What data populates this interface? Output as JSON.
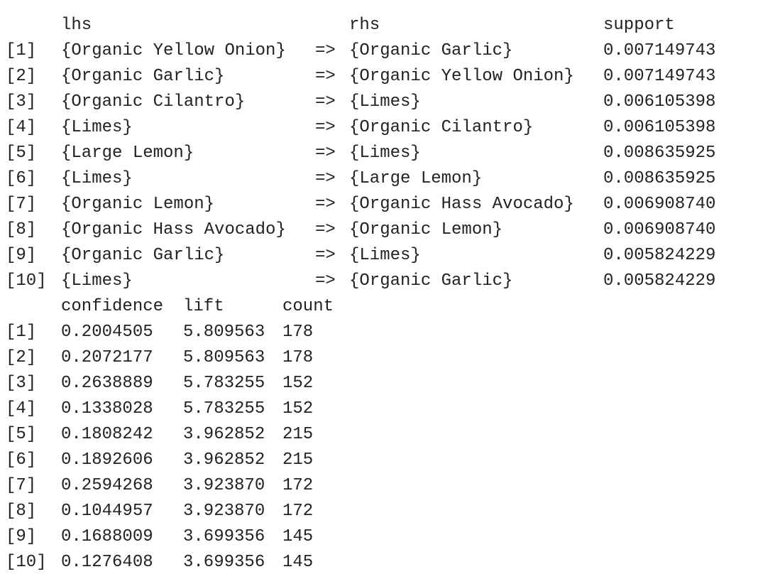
{
  "rules_table": {
    "headers": {
      "lhs": "lhs",
      "rhs": "rhs",
      "support": "support"
    },
    "rows": [
      {
        "idx": "[1]",
        "lhs": "{Organic Yellow Onion}",
        "arrow": "=>",
        "rhs": "{Organic Garlic}",
        "support": "0.007149743"
      },
      {
        "idx": "[2]",
        "lhs": "{Organic Garlic}",
        "arrow": "=>",
        "rhs": "{Organic Yellow Onion}",
        "support": "0.007149743"
      },
      {
        "idx": "[3]",
        "lhs": "{Organic Cilantro}",
        "arrow": "=>",
        "rhs": "{Limes}",
        "support": "0.006105398"
      },
      {
        "idx": "[4]",
        "lhs": "{Limes}",
        "arrow": "=>",
        "rhs": "{Organic Cilantro}",
        "support": "0.006105398"
      },
      {
        "idx": "[5]",
        "lhs": "{Large Lemon}",
        "arrow": "=>",
        "rhs": "{Limes}",
        "support": "0.008635925"
      },
      {
        "idx": "[6]",
        "lhs": "{Limes}",
        "arrow": "=>",
        "rhs": "{Large Lemon}",
        "support": "0.008635925"
      },
      {
        "idx": "[7]",
        "lhs": "{Organic Lemon}",
        "arrow": "=>",
        "rhs": "{Organic Hass Avocado}",
        "support": "0.006908740"
      },
      {
        "idx": "[8]",
        "lhs": "{Organic Hass Avocado}",
        "arrow": "=>",
        "rhs": "{Organic Lemon}",
        "support": "0.006908740"
      },
      {
        "idx": "[9]",
        "lhs": "{Organic Garlic}",
        "arrow": "=>",
        "rhs": "{Limes}",
        "support": "0.005824229"
      },
      {
        "idx": "[10]",
        "lhs": "{Limes}",
        "arrow": "=>",
        "rhs": "{Organic Garlic}",
        "support": "0.005824229"
      }
    ]
  },
  "metrics_table": {
    "headers": {
      "confidence": "confidence",
      "lift": "lift",
      "count": "count"
    },
    "rows": [
      {
        "idx": "[1]",
        "confidence": "0.2004505",
        "lift": "5.809563",
        "count": "178"
      },
      {
        "idx": "[2]",
        "confidence": "0.2072177",
        "lift": "5.809563",
        "count": "178"
      },
      {
        "idx": "[3]",
        "confidence": "0.2638889",
        "lift": "5.783255",
        "count": "152"
      },
      {
        "idx": "[4]",
        "confidence": "0.1338028",
        "lift": "5.783255",
        "count": "152"
      },
      {
        "idx": "[5]",
        "confidence": "0.1808242",
        "lift": "3.962852",
        "count": "215"
      },
      {
        "idx": "[6]",
        "confidence": "0.1892606",
        "lift": "3.962852",
        "count": "215"
      },
      {
        "idx": "[7]",
        "confidence": "0.2594268",
        "lift": "3.923870",
        "count": "172"
      },
      {
        "idx": "[8]",
        "confidence": "0.1044957",
        "lift": "3.923870",
        "count": "172"
      },
      {
        "idx": "[9]",
        "confidence": "0.1688009",
        "lift": "3.699356",
        "count": "145"
      },
      {
        "idx": "[10]",
        "confidence": "0.1276408",
        "lift": "3.699356",
        "count": "145"
      }
    ]
  }
}
